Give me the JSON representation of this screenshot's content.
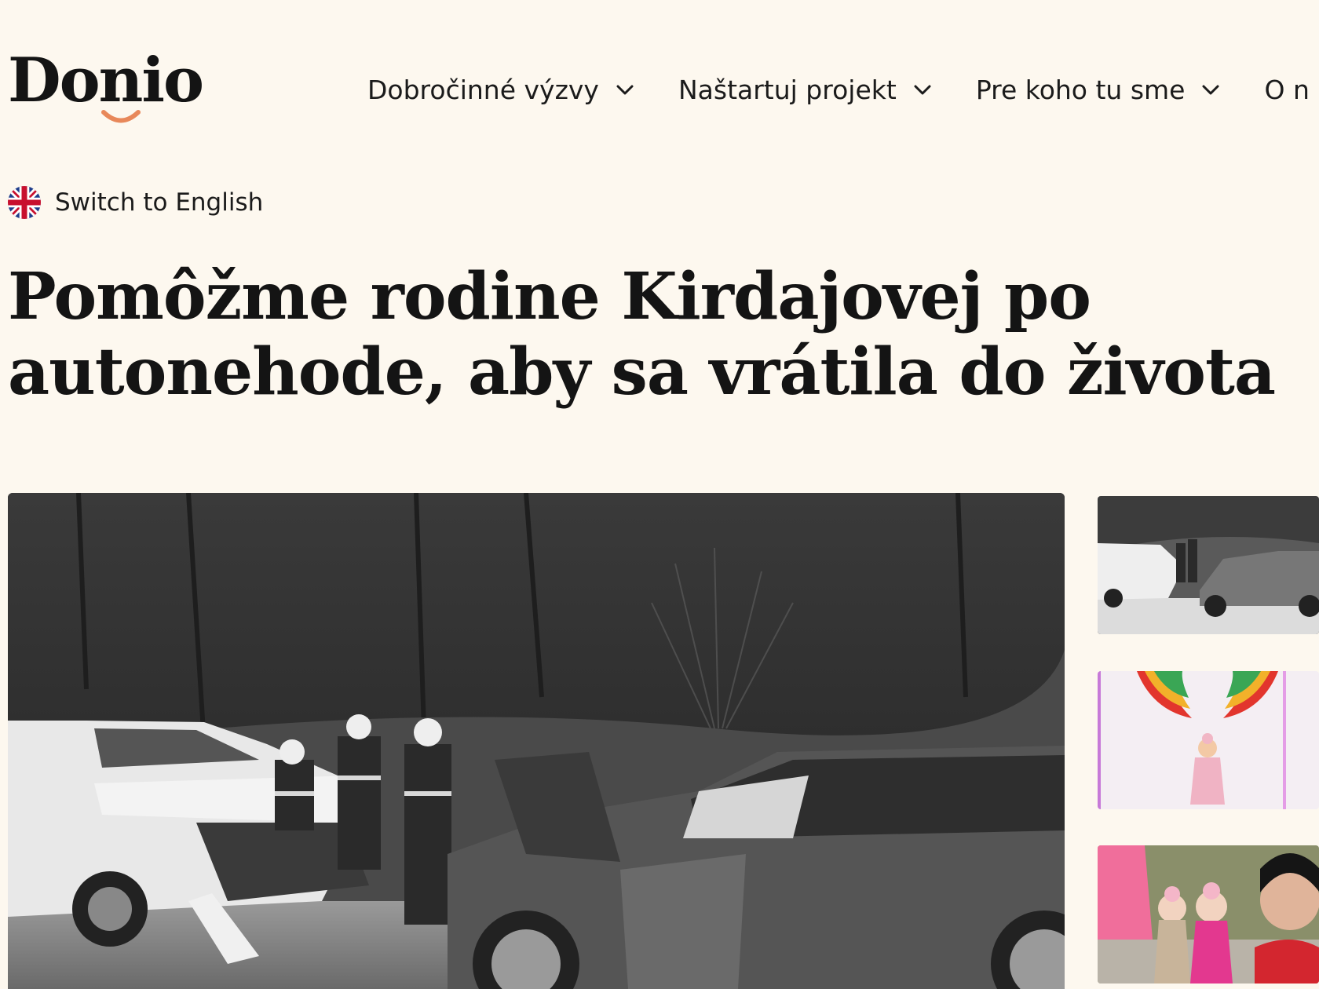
{
  "brand": {
    "logo_text": "Donio",
    "accent_color": "#e8885a"
  },
  "nav": {
    "items": [
      {
        "label": "Dobročinné výzvy",
        "icon": "chevron-down-icon"
      },
      {
        "label": "Naštartuj projekt",
        "icon": "chevron-down-icon"
      },
      {
        "label": "Pre koho tu sme",
        "icon": "chevron-down-icon"
      },
      {
        "label": "O n",
        "icon": "chevron-down-icon"
      }
    ]
  },
  "language": {
    "label": "Switch to English",
    "icon": "uk-flag-icon"
  },
  "campaign": {
    "title": "Pomôžme rodine Kirdajovej po autonehode, aby sa vrátila do života"
  },
  "gallery": {
    "thumbnails": [
      {
        "name": "crash-scene-thumbnail"
      },
      {
        "name": "child-wings-wall-thumbnail"
      },
      {
        "name": "family-selfie-thumbnail"
      }
    ]
  },
  "colors": {
    "background": "#fdf8ef",
    "text": "#161616"
  }
}
